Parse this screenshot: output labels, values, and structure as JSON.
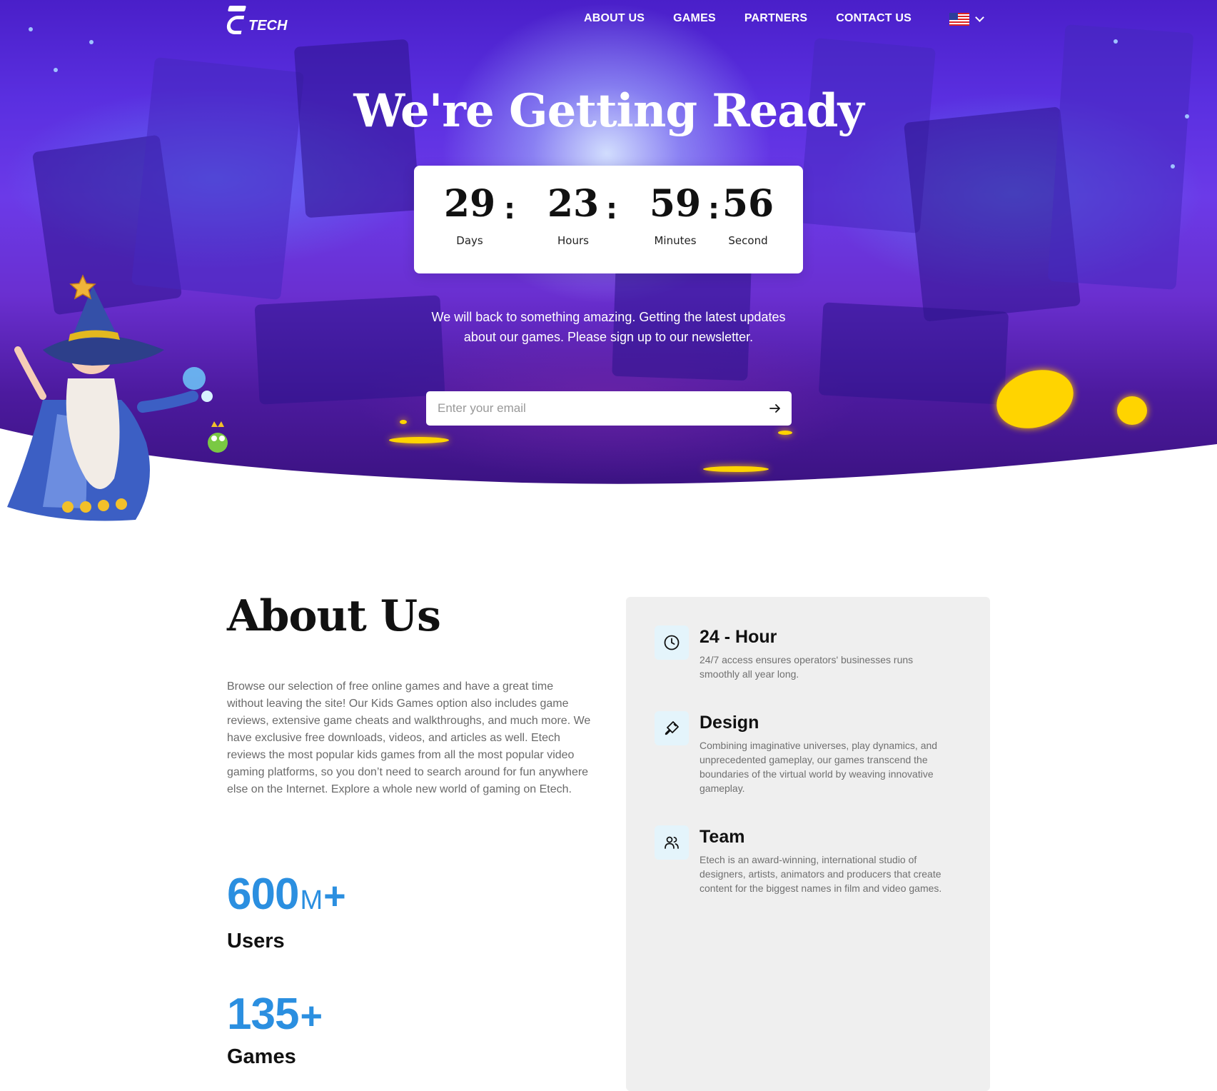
{
  "brand": {
    "logo_text": "TECH"
  },
  "nav": {
    "items": [
      {
        "label": "ABOUT US"
      },
      {
        "label": "GAMES"
      },
      {
        "label": "PARTNERS"
      },
      {
        "label": "CONTACT US"
      }
    ],
    "language_icon": "us-flag-icon"
  },
  "hero": {
    "title": "We're Getting Ready",
    "countdown": {
      "days": {
        "value": "29",
        "label": "Days"
      },
      "hours": {
        "value": "23",
        "label": "Hours"
      },
      "minutes": {
        "value": "59",
        "label": "Minutes"
      },
      "seconds": {
        "value": "56",
        "label": "Second"
      },
      "separator": ":"
    },
    "description": "We will back to something amazing. Getting the latest updates about our games. Please sign up to our newsletter.",
    "email": {
      "placeholder": "Enter your email",
      "value": ""
    }
  },
  "about": {
    "title": "About Us",
    "text": "Browse our selection of free online games and have a great time without leaving the site! Our Kids Games option also includes game reviews, extensive game cheats and walkthroughs, and much more. We have exclusive free downloads, videos, and articles as well. Etech reviews the most popular kids games from all the most popular video gaming platforms, so you don’t need to search around for fun anywhere else on the Internet. Explore a whole new world of gaming on Etech.",
    "stats": [
      {
        "value": "600",
        "unit": "M",
        "suffix": "+",
        "caption": "Users"
      },
      {
        "value": "135",
        "unit": "",
        "suffix": "+",
        "caption": "Games"
      }
    ],
    "features": [
      {
        "icon": "clock-icon",
        "title": "24 - Hour",
        "description": "24/7 access ensures operators' businesses runs smoothly all year long."
      },
      {
        "icon": "paintbrush-icon",
        "title": "Design",
        "description": "Combining imaginative universes, play dynamics, and unprecedented gameplay, our games transcend the boundaries of the virtual world by weaving innovative gameplay."
      },
      {
        "icon": "users-icon",
        "title": "Team",
        "description": "Etech is an award-winning, international studio of designers, artists, animators and producers that create content for the biggest names in film and video games."
      }
    ]
  },
  "colors": {
    "accent": "#2b8fe0",
    "hero_purple": "#5a2fe0",
    "feature_bg": "#efefef"
  }
}
